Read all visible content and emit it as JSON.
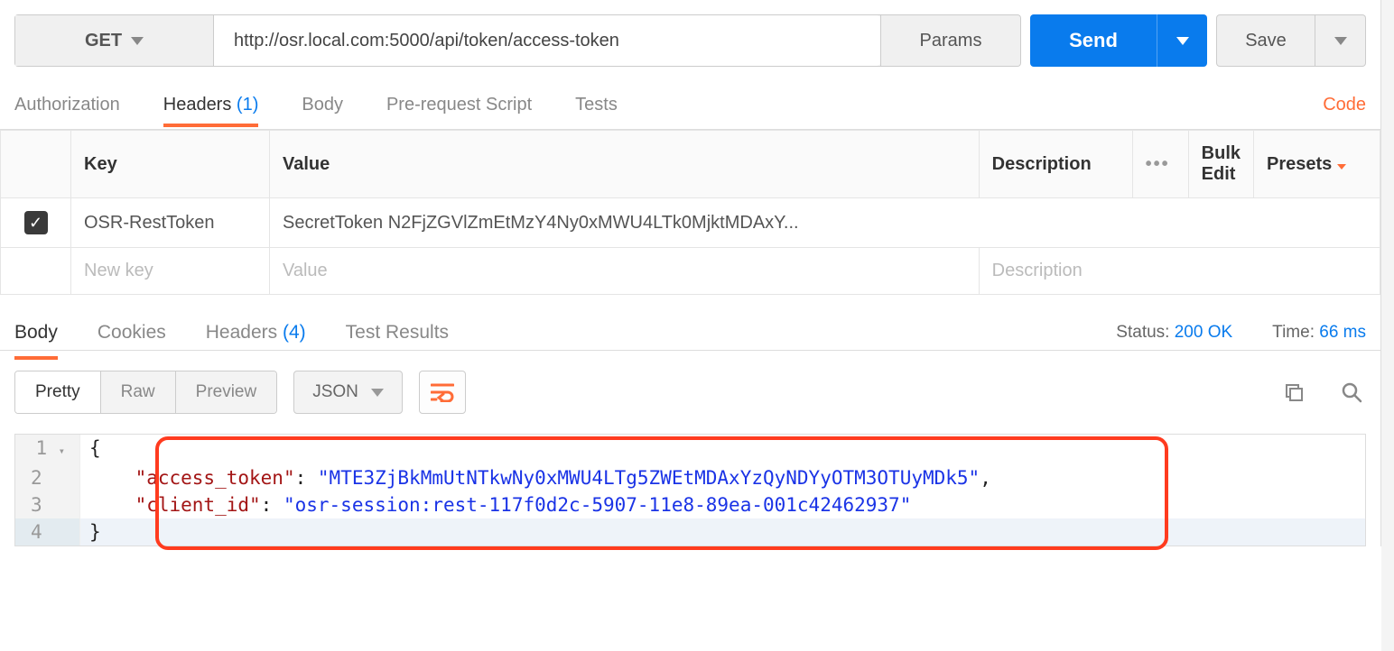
{
  "request": {
    "method": "GET",
    "url": "http://osr.local.com:5000/api/token/access-token",
    "params_label": "Params",
    "send_label": "Send",
    "save_label": "Save"
  },
  "request_tabs": {
    "authorization": "Authorization",
    "headers": "Headers",
    "headers_count": "(1)",
    "body": "Body",
    "prerequest": "Pre-request Script",
    "tests": "Tests",
    "code": "Code"
  },
  "headers_table": {
    "col_key": "Key",
    "col_value": "Value",
    "col_description": "Description",
    "bulk_edit": "Bulk Edit",
    "presets": "Presets",
    "rows": [
      {
        "checked": true,
        "key": "OSR-RestToken",
        "value": "SecretToken N2FjZGVlZmEtMzY4Ny0xMWU4LTk0MjktMDAxY..."
      }
    ],
    "placeholder_key": "New key",
    "placeholder_value": "Value",
    "placeholder_description": "Description"
  },
  "response_tabs": {
    "body": "Body",
    "cookies": "Cookies",
    "headers": "Headers",
    "headers_count": "(4)",
    "tests": "Test Results"
  },
  "response_meta": {
    "status_label": "Status:",
    "status_value": "200 OK",
    "time_label": "Time:",
    "time_value": "66 ms"
  },
  "body_toolbar": {
    "pretty": "Pretty",
    "raw": "Raw",
    "preview": "Preview",
    "format": "JSON"
  },
  "response_body": {
    "line1": "{",
    "line2_key": "\"access_token\"",
    "line2_value": "\"MTE3ZjBkMmUtNTkwNy0xMWU4LTg5ZWEtMDAxYzQyNDYyOTM3OTUyMDk5\"",
    "line3_key": "\"client_id\"",
    "line3_value": "\"osr-session:rest-117f0d2c-5907-11e8-89ea-001c42462937\"",
    "line4": "}",
    "numbers": [
      "1",
      "2",
      "3",
      "4"
    ]
  }
}
